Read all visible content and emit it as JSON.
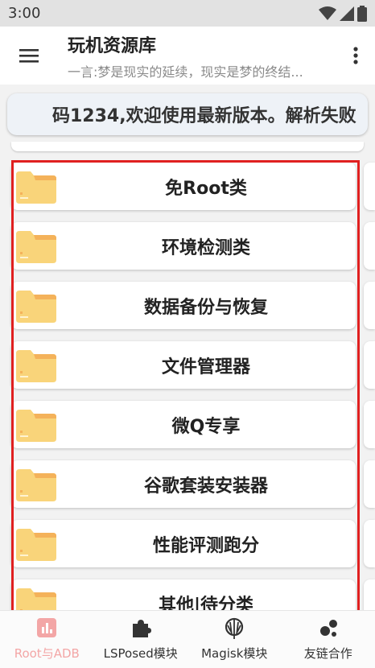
{
  "status": {
    "time": "3:00"
  },
  "app": {
    "title": "玩机资源库",
    "subtitle": "一言:梦是现实的延续，现实是梦的终结..."
  },
  "marquee": {
    "text": "码1234,欢迎使用最新版本。解析失败"
  },
  "categories": [
    {
      "label": "免Root类"
    },
    {
      "label": "环境检测类"
    },
    {
      "label": "数据备份与恢复"
    },
    {
      "label": "文件管理器"
    },
    {
      "label": "微Q专享"
    },
    {
      "label": "谷歌套装安装器"
    },
    {
      "label": "性能评测跑分"
    },
    {
      "label": "其他|待分类"
    }
  ],
  "bottom_nav": [
    {
      "label": "Root与ADB",
      "icon": "chart-icon",
      "active": true
    },
    {
      "label": "LSPosed模块",
      "icon": "puzzle-icon",
      "active": false
    },
    {
      "label": "Magisk模块",
      "icon": "magisk-icon",
      "active": false
    },
    {
      "label": "友链合作",
      "icon": "dots-icon",
      "active": false
    }
  ],
  "colors": {
    "highlight": "#e02020",
    "folder": "#f9d47a",
    "folder_tab": "#f4b25a",
    "nav_active": "#f3a6a6"
  }
}
